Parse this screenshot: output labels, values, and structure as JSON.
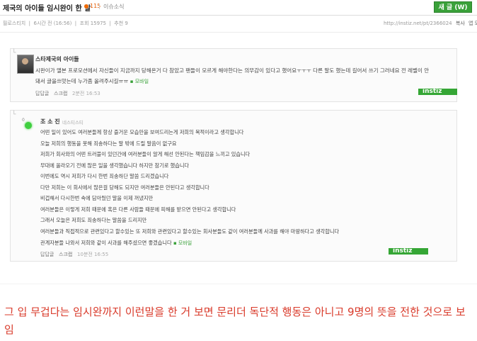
{
  "header": {
    "title": "제국의 아이들 임시완이 한 말",
    "hot_count": "115",
    "category": "이슈소식",
    "new_button": "새 글 (W)"
  },
  "meta": {
    "author": "필로스티치",
    "time": "6시간 전 (16:56)",
    "views": "조회 15975",
    "likes": "추천 9",
    "url": "http://instiz.net/pt/2366024",
    "copy": "복사",
    "short": "앱 모음"
  },
  "comment1": {
    "name": "스타제국의 아이들",
    "line1": "시완이가 앨본 프로모션에서 자신들이 지금까지 당해온거 다 참았고 팬들이 모르게 해야한다는 의무감이 있다고 했어요ㅜㅜㅜ 다른 말도 했는데 길어서 쓰기 그러네요 전 레벨이 안",
    "line2": "돼서 글을쓰맛는데 누가좀 올려주시길ㅠㅠ",
    "mobile": "모바일",
    "reply": "답답글",
    "scrap": "스크랩",
    "time": "2분전 16:53",
    "instiz": "instiz"
  },
  "comment2": {
    "name": "조 소 진",
    "subtitle": "네스티스티",
    "dot": "0",
    "lines": [
      "어떤 일이 있어도 여러분들께 항상 즐거운 모습만을 보여드리는게 저희의 목적이라고 생각합니다",
      "오늘 저희의 행동을 못해 죄송하다는 말 밖에 드릴 말씀이 없구요",
      "저희가 회사와의 어떤 트러블이 있던간에 여러분들이 알게 해선 안된다는 책임감을 느끼고 있습니다",
      "무대에 올라오기 전에 많은 일을 생각했습니다 하지만 참기로 했습니다",
      "이번에도 역시 저희가 다시 한번 죄송하단 말씀 드리겠습니다",
      "다만 저희는 이 회사에서 많은걸 당해도 되지만 여러분들은 안된다고 생각합니다",
      "비겁해서 다시한번 속에 담아뒀던 말을 이제 꺼냈지만",
      "여러분들은 이렇게 저희 때문에 혹은 다른 사람들 때문에 피해를 받으면 안된다고 생각합니다",
      "그래서 오늘은 저희도 죄송하다는 말씀을 드리지만",
      "여러분들과 직접적으로 관련있다고 할수있는 또 저희와 관련있다고 할수있는 회사분들도 같이 여러분들께 사과를 해야 마땅하다고 생각합니다",
      "관계자분들 나와서 저희와 같이 사과를 해주셨으면 좋겠습니다"
    ],
    "mobile": "모바일",
    "reply": "답답글",
    "scrap": "스크랩",
    "time": "10분전 16:55",
    "instiz": "instiz"
  },
  "caption": "그 입 무겁다는 임시완까지 이런말을 한 거 보면 문리더 독단적 행동은 아니고 9명의 뜻을 전한 것으로 보임",
  "colors": {
    "accent_green": "#3aa13a",
    "caption_red": "#d93a2a"
  }
}
